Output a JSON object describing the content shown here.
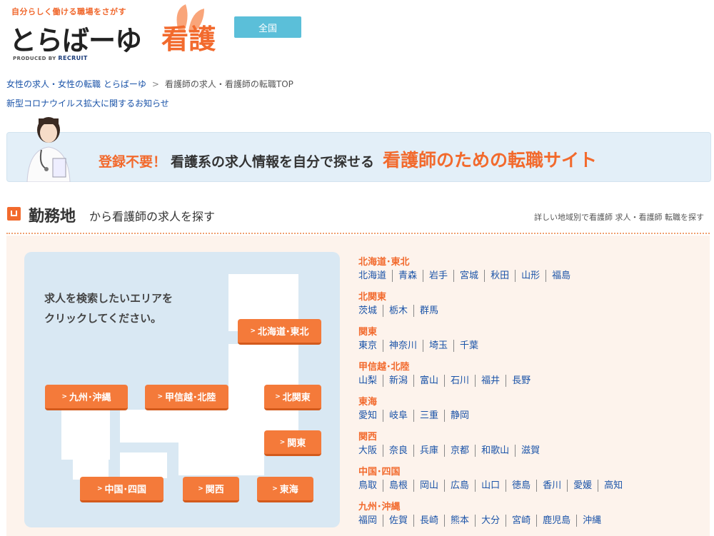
{
  "header": {
    "tagline": "自分らしく働ける職場をさがす",
    "logo_main": "とらばーゆ",
    "logo_sub": "看護",
    "produced": "PRODUCED BY",
    "produced_brand": "RECRUIT",
    "area_button": "全国"
  },
  "breadcrumb": {
    "home": "女性の求人・女性の転職 とらばーゆ",
    "separator": ">",
    "current": "看護師の求人・看護師の転職TOP"
  },
  "notice": "新型コロナウイルス拡大に関するお知らせ",
  "banner": {
    "text1": "登録不要！",
    "text2": "看護系の求人情報を自分で探せる",
    "text3": "看護師のための転職サイト"
  },
  "section": {
    "title": "勤務地",
    "subtitle": "から看護師の求人を探す",
    "right_link": "詳しい地域別で看護師 求人・看護師 転職を探す"
  },
  "map": {
    "instruction_line1": "求人を検索したいエリアを",
    "instruction_line2": "クリックしてください。",
    "buttons": {
      "hokkaido_tohoku": "北海道･東北",
      "kyushu_okinawa": "九州･沖縄",
      "koshinetsu_hokuriku": "甲信越･北陸",
      "kitakanto": "北関東",
      "kanto": "関東",
      "chugoku_shikoku": "中国･四国",
      "kansai": "関西",
      "tokai": "東海"
    }
  },
  "regions": [
    {
      "name": "北海道･東北",
      "prefs": [
        "北海道",
        "青森",
        "岩手",
        "宮城",
        "秋田",
        "山形",
        "福島"
      ]
    },
    {
      "name": "北関東",
      "prefs": [
        "茨城",
        "栃木",
        "群馬"
      ]
    },
    {
      "name": "関東",
      "prefs": [
        "東京",
        "神奈川",
        "埼玉",
        "千葉"
      ]
    },
    {
      "name": "甲信越･北陸",
      "prefs": [
        "山梨",
        "新潟",
        "富山",
        "石川",
        "福井",
        "長野"
      ]
    },
    {
      "name": "東海",
      "prefs": [
        "愛知",
        "岐阜",
        "三重",
        "静岡"
      ]
    },
    {
      "name": "関西",
      "prefs": [
        "大阪",
        "奈良",
        "兵庫",
        "京都",
        "和歌山",
        "滋賀"
      ]
    },
    {
      "name": "中国･四国",
      "prefs": [
        "鳥取",
        "島根",
        "岡山",
        "広島",
        "山口",
        "徳島",
        "香川",
        "愛媛",
        "高知"
      ]
    },
    {
      "name": "九州･沖縄",
      "prefs": [
        "福岡",
        "佐賀",
        "長崎",
        "熊本",
        "大分",
        "宮崎",
        "鹿児島",
        "沖縄"
      ]
    }
  ],
  "colors": {
    "accent": "#f26a2d",
    "link": "#1a53a8",
    "area_button": "#5bbfd9",
    "map_bg": "#d9e8f3",
    "section_bg": "#fdf3ec"
  }
}
